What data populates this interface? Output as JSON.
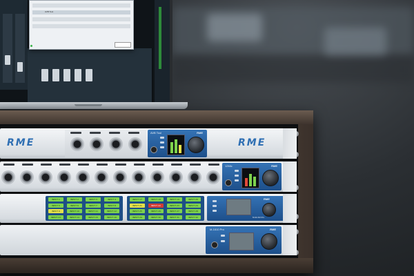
{
  "scene": {
    "description_colors": {
      "rack_wood": "#4e4037",
      "rme_blue": "#2f6fb3",
      "panel_blue": "#2a62a2",
      "meter_green": "#7ed24d",
      "channel_red": "#d23b33"
    }
  },
  "laptop": {
    "dialog": {
      "rows": [
        "",
        "AVB Tool",
        "",
        ""
      ],
      "status": ""
    }
  },
  "devices": {
    "unit1": {
      "logo_left": "RME",
      "logo_right": "RME",
      "panel_logo": "RME",
      "panel_label": "AVB Tool"
    },
    "unit2": {
      "panel_logo": "RME",
      "panel_label": "12Mic"
    },
    "unit3": {
      "panel_logo": "RME",
      "model": "M-32 AD Pro"
    },
    "unit4": {
      "panel_label": "M-1610 Pro",
      "panel_logo": "RME"
    }
  },
  "unit3_channels": {
    "left_bank": [
      [
        "INPUT 1",
        "INPUT 2",
        "INPUT 3",
        "INPUT 4"
      ],
      [
        "INPUT 5",
        "INPUT 6",
        "INPUT 7",
        "INPUT 8"
      ],
      [
        "INPUT 9",
        "INPUT 10",
        "INPUT 11",
        "INPUT 12"
      ],
      [
        "INPUT 13",
        "INPUT 14",
        "INPUT 15",
        "INPUT 16"
      ]
    ],
    "right_bank": [
      [
        "INPUT 17",
        "INPUT 18",
        "INPUT 19",
        "INPUT 20"
      ],
      [
        "INPUT 21",
        "INPUT 22",
        "INPUT 23",
        "INPUT 24"
      ],
      [
        "INPUT 25",
        "INPUT 26",
        "INPUT 27",
        "INPUT 28"
      ],
      [
        "INPUT 29",
        "INPUT 30",
        "INPUT 31",
        "INPUT 32"
      ]
    ],
    "highlight": {
      "yellow": [
        "INPUT 9",
        "INPUT 21"
      ],
      "red": [
        "INPUT 22"
      ]
    }
  }
}
